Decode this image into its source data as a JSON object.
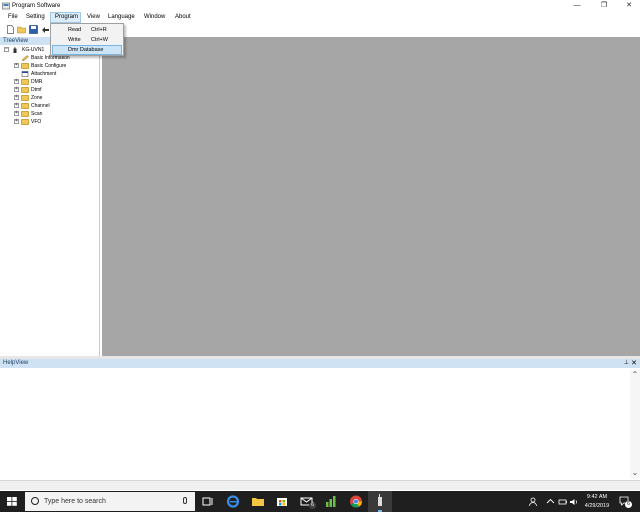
{
  "window": {
    "title": "Program Software",
    "controls": {
      "minimize": "—",
      "restore": "❐",
      "close": "✕"
    }
  },
  "menubar": {
    "items": [
      {
        "label": "File"
      },
      {
        "label": "Setting"
      },
      {
        "label": "Program"
      },
      {
        "label": "View"
      },
      {
        "label": "Language"
      },
      {
        "label": "Window"
      },
      {
        "label": "About"
      }
    ]
  },
  "program_menu": {
    "items": [
      {
        "label": "Read",
        "shortcut": "Ctrl+R"
      },
      {
        "label": "Write",
        "shortcut": "Ctrl+W"
      },
      {
        "label": "Dmr Database",
        "shortcut": ""
      }
    ]
  },
  "toolbar": {
    "icons": [
      "new-file-icon",
      "open-folder-icon",
      "save-icon",
      "read-radio-icon"
    ]
  },
  "treeview": {
    "title": "TreeView",
    "root": "KG-UVN1",
    "items": [
      {
        "label": "Basic Information",
        "icon": "pencil-icon",
        "expandable": false
      },
      {
        "label": "Basic Configure",
        "icon": "folder-icon",
        "expandable": true
      },
      {
        "label": "Attachment",
        "icon": "grid-icon",
        "expandable": false
      },
      {
        "label": "DMR",
        "icon": "folder-icon",
        "expandable": true
      },
      {
        "label": "Dtmf",
        "icon": "folder-icon",
        "expandable": true
      },
      {
        "label": "Zone",
        "icon": "folder-icon",
        "expandable": true
      },
      {
        "label": "Channel",
        "icon": "folder-icon",
        "expandable": true
      },
      {
        "label": "Scan",
        "icon": "folder-icon",
        "expandable": true
      },
      {
        "label": "VFO",
        "icon": "folder-icon",
        "expandable": true
      }
    ]
  },
  "helpview": {
    "title": "HelpView",
    "pin": "⊥",
    "close": "✕"
  },
  "taskbar": {
    "search_placeholder": "Type here to search",
    "time": "9:42 AM",
    "date": "4/29/2019",
    "notification_count": "6",
    "mail_badge": "6"
  }
}
